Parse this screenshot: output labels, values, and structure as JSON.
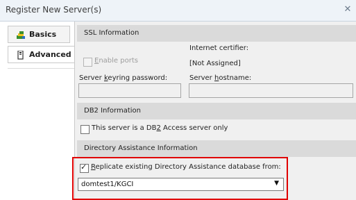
{
  "window": {
    "title": "Register New Server(s)",
    "close_icon": "close-icon"
  },
  "tabs": [
    {
      "label": "Basics",
      "icon": "basics-icon",
      "active": false
    },
    {
      "label": "Advanced",
      "icon": "advanced-icon",
      "active": true
    }
  ],
  "ssl": {
    "section_title": "SSL Information",
    "enable_ports_pre": "",
    "enable_ports_u": "E",
    "enable_ports_post": "nable ports",
    "enable_ports_checked": false,
    "enable_ports_enabled": false,
    "certifier_label": "Internet certifier:",
    "certifier_value": "[Not Assigned]",
    "keyring_pre": "Server ",
    "keyring_u": "k",
    "keyring_post": "eyring password:",
    "keyring_value": "",
    "hostname_pre": "Server ",
    "hostname_u": "h",
    "hostname_post": "ostname:",
    "hostname_value": ""
  },
  "db2": {
    "section_title": "DB2 Information",
    "checkbox_pre": "This server is a DB",
    "checkbox_u": "2",
    "checkbox_post": " Access server only",
    "checked": false
  },
  "directory": {
    "section_title": "Directory Assistance Information",
    "replicate_pre": "",
    "replicate_u": "R",
    "replicate_post": "eplicate existing Directory Assistance database from:",
    "replicate_checked": true,
    "source_value": "domtest1/KGCI",
    "dropdown_icon": "chevron-down-icon"
  },
  "colors": {
    "highlight_border": "#e00000",
    "section_bar": "#dadada",
    "panel_bg": "#f0f0f0"
  }
}
